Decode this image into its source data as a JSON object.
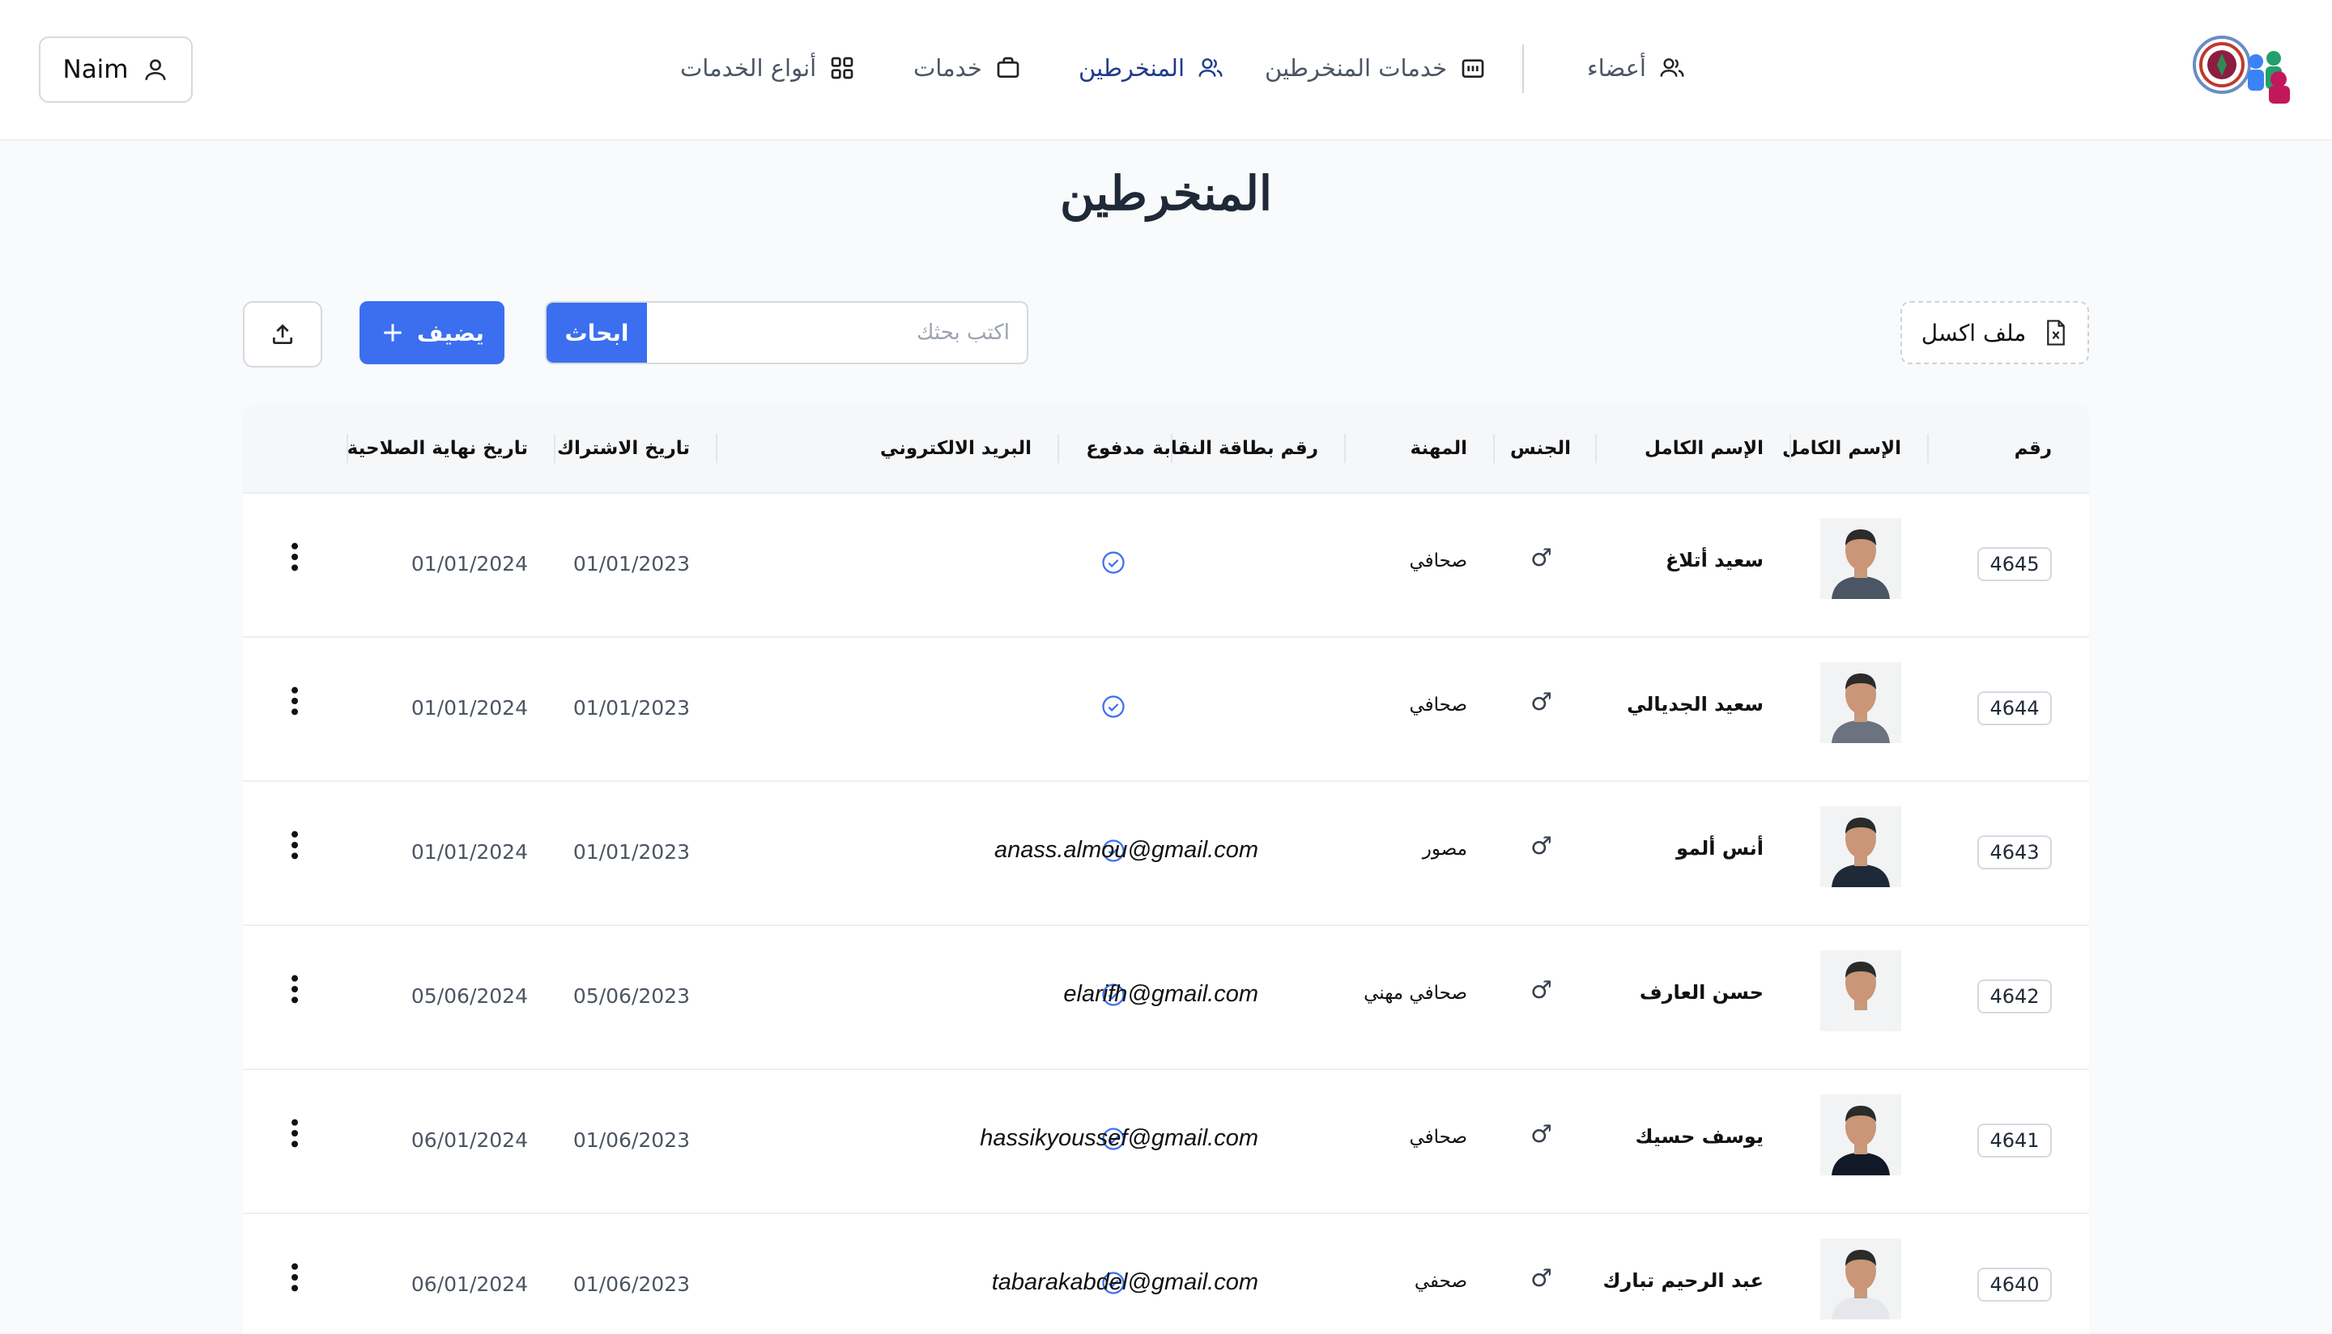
{
  "header": {
    "user_name": "Naim",
    "nav": [
      {
        "label": "أعضاء",
        "icon": "users-icon"
      },
      {
        "label": "خدمات المنخرطين",
        "icon": "calendar-icon"
      },
      {
        "label": "المنخرطين",
        "icon": "users-icon",
        "active": true
      },
      {
        "label": "خدمات",
        "icon": "briefcase-icon"
      },
      {
        "label": "أنواع الخدمات",
        "icon": "grid-icon"
      }
    ],
    "active_color": "#1e3a8a"
  },
  "page": {
    "title": "المنخرطين"
  },
  "toolbar": {
    "add_label": "يضيف",
    "search_button": "ابحاث",
    "search_placeholder": "اكتب بحثك",
    "search_value": "",
    "excel_label": "ملف اكسل",
    "accent": "#3b6ff0"
  },
  "table": {
    "headers": {
      "number": "رقم",
      "photo": "الإسم الكامل",
      "full_name": "الإسم الكامل",
      "gender": "الجنس",
      "job": "المهنة",
      "card": "رقم بطاقة النقابة",
      "paid": "مدفوع",
      "email": "البريد الالكتروني",
      "sub_date": "تاريخ الاشتراك",
      "exp_date": "تاريخ نهاية الصلاحية"
    },
    "rows": [
      {
        "number": "4645",
        "name": "سعيد أتلاغ",
        "gender": "♂",
        "job": "صحافي",
        "card": "",
        "paid": true,
        "email": "",
        "sub_date": "01/01/2023",
        "exp_date": "01/01/2024"
      },
      {
        "number": "4644",
        "name": "سعيد الجديالي",
        "gender": "♂",
        "job": "صحافي",
        "card": "",
        "paid": true,
        "email": "",
        "sub_date": "01/01/2023",
        "exp_date": "01/01/2024"
      },
      {
        "number": "4643",
        "name": "أنس ألمو",
        "gender": "♂",
        "job": "مصور",
        "card": "",
        "paid": true,
        "email": "anass.almou@gmail.com",
        "sub_date": "01/01/2023",
        "exp_date": "01/01/2024"
      },
      {
        "number": "4642",
        "name": "حسن العارف",
        "gender": "♂",
        "job": "صحافي مهني",
        "card": "",
        "paid": true,
        "email": "elarifh@gmail.com",
        "sub_date": "05/06/2023",
        "exp_date": "05/06/2024"
      },
      {
        "number": "4641",
        "name": "يوسف حسيك",
        "gender": "♂",
        "job": "صحافي",
        "card": "",
        "paid": true,
        "email": "hassikyoussef@gmail.com",
        "sub_date": "01/06/2023",
        "exp_date": "06/01/2024"
      },
      {
        "number": "4640",
        "name": "عبد الرحيم تبارك",
        "gender": "♂",
        "job": "صحفي",
        "card": "",
        "paid": true,
        "email": "tabarakabdel@gmail.com",
        "sub_date": "01/06/2023",
        "exp_date": "06/01/2024"
      }
    ]
  }
}
